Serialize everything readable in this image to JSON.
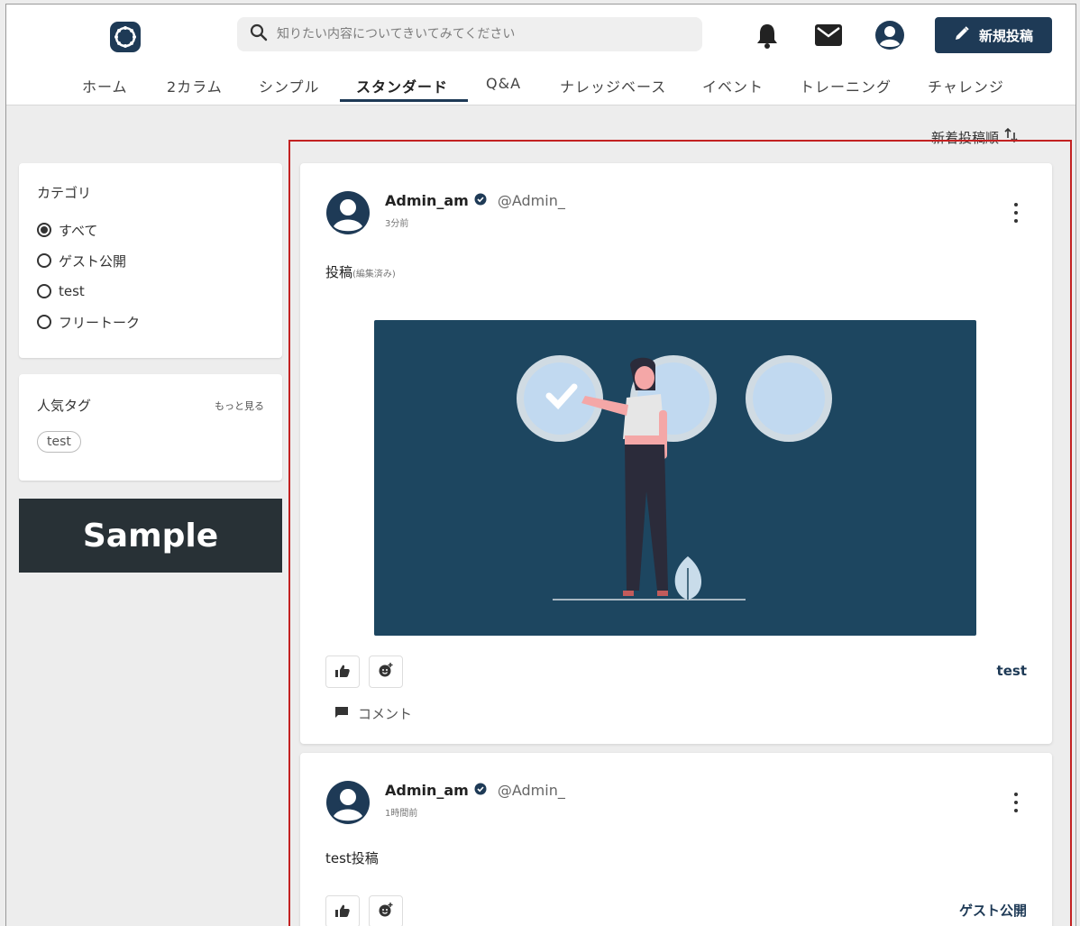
{
  "header": {
    "search_placeholder": "知りたい内容についてきいてみてください",
    "new_post_label": "新規投稿",
    "icons": [
      "logo-icon",
      "search-icon",
      "bell-icon",
      "mail-icon",
      "account-icon",
      "pencil-icon"
    ],
    "brand_color": "#1e3a56"
  },
  "nav": {
    "items": [
      {
        "label": "ホーム"
      },
      {
        "label": "2カラム"
      },
      {
        "label": "シンプル"
      },
      {
        "label": "スタンダード",
        "active": true
      },
      {
        "label": "Q&A"
      },
      {
        "label": "ナレッジベース"
      },
      {
        "label": "イベント"
      },
      {
        "label": "トレーニング"
      },
      {
        "label": "チャレンジ"
      }
    ]
  },
  "sort": {
    "label": "新着投稿順"
  },
  "sidebar": {
    "category_title": "カテゴリ",
    "categories": [
      {
        "label": "すべて",
        "selected": true
      },
      {
        "label": "ゲスト公開",
        "selected": false
      },
      {
        "label": "test",
        "selected": false
      },
      {
        "label": "フリートーク",
        "selected": false
      }
    ],
    "tags_title": "人気タグ",
    "more_label": "もっと見る",
    "tags": [
      "test"
    ],
    "banner_text": "Sample"
  },
  "posts": [
    {
      "author": "Admin_am",
      "handle": "@Admin_",
      "time": "3分前",
      "body": "投稿",
      "edited": "(編集済み)",
      "category": "test",
      "comment_label": "コメント"
    },
    {
      "author": "Admin_am",
      "handle": "@Admin_",
      "time": "1時間前",
      "body": "test投稿",
      "category": "ゲスト公開"
    }
  ]
}
